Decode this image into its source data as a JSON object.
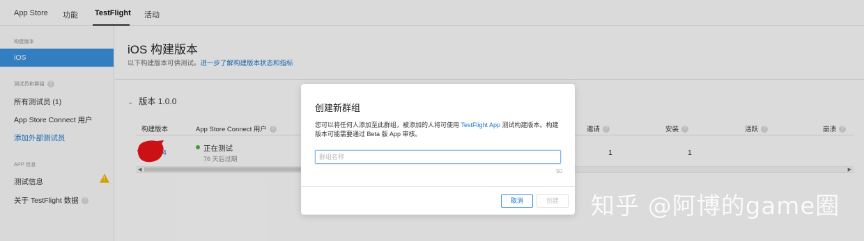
{
  "topnav": {
    "tabs": [
      {
        "label": "App Store"
      },
      {
        "label": "功能"
      },
      {
        "label": "TestFlight",
        "active": true
      },
      {
        "label": "活动"
      }
    ]
  },
  "sidebar": {
    "section_builds": "构建版本",
    "item_ios": "iOS",
    "section_testers": "测试员和群组",
    "all_testers": "所有测试员 (1)",
    "asc_users": "App Store Connect 用户",
    "add_external": "添加外部测试员",
    "section_app_info": "APP 信息",
    "test_info": "测试信息",
    "about_testflight": "关于 TestFlight 数据",
    "help_glyph": "?",
    "warning_glyph": "!"
  },
  "main": {
    "title": "iOS 构建版本",
    "subtitle": "以下构建版本可供测试。",
    "subtitle_link": "进一步了解构建版本状态和指标",
    "version_label": "版本 1.0.0",
    "columns": {
      "build": "构建版本",
      "asc": "App Store Connect 用户",
      "invites": "邀请",
      "installs": "安装",
      "active": "活跃",
      "crashes": "崩溃"
    },
    "row": {
      "build": "4",
      "status": "正在测试",
      "expiry": "76 天后过期",
      "invites": "1",
      "installs": "1"
    }
  },
  "modal": {
    "title": "创建新群组",
    "desc_before": "您可以将任何人添加至此群组，被添加的人将可使用 ",
    "desc_link": "TestFlight App",
    "desc_after": " 测试构建版本。构建版本可能需要通过 Beta 版 App 审核。",
    "input_placeholder": "群组名称",
    "input_value": "",
    "char_count": "50",
    "cancel_label": "取消",
    "create_label": "创建"
  },
  "watermark": "知乎 @阿博的game圈",
  "colors": {
    "accent": "#3b8fdc",
    "link": "#1a73c7",
    "status_green": "#4cae3c",
    "warning": "#f2b600"
  }
}
